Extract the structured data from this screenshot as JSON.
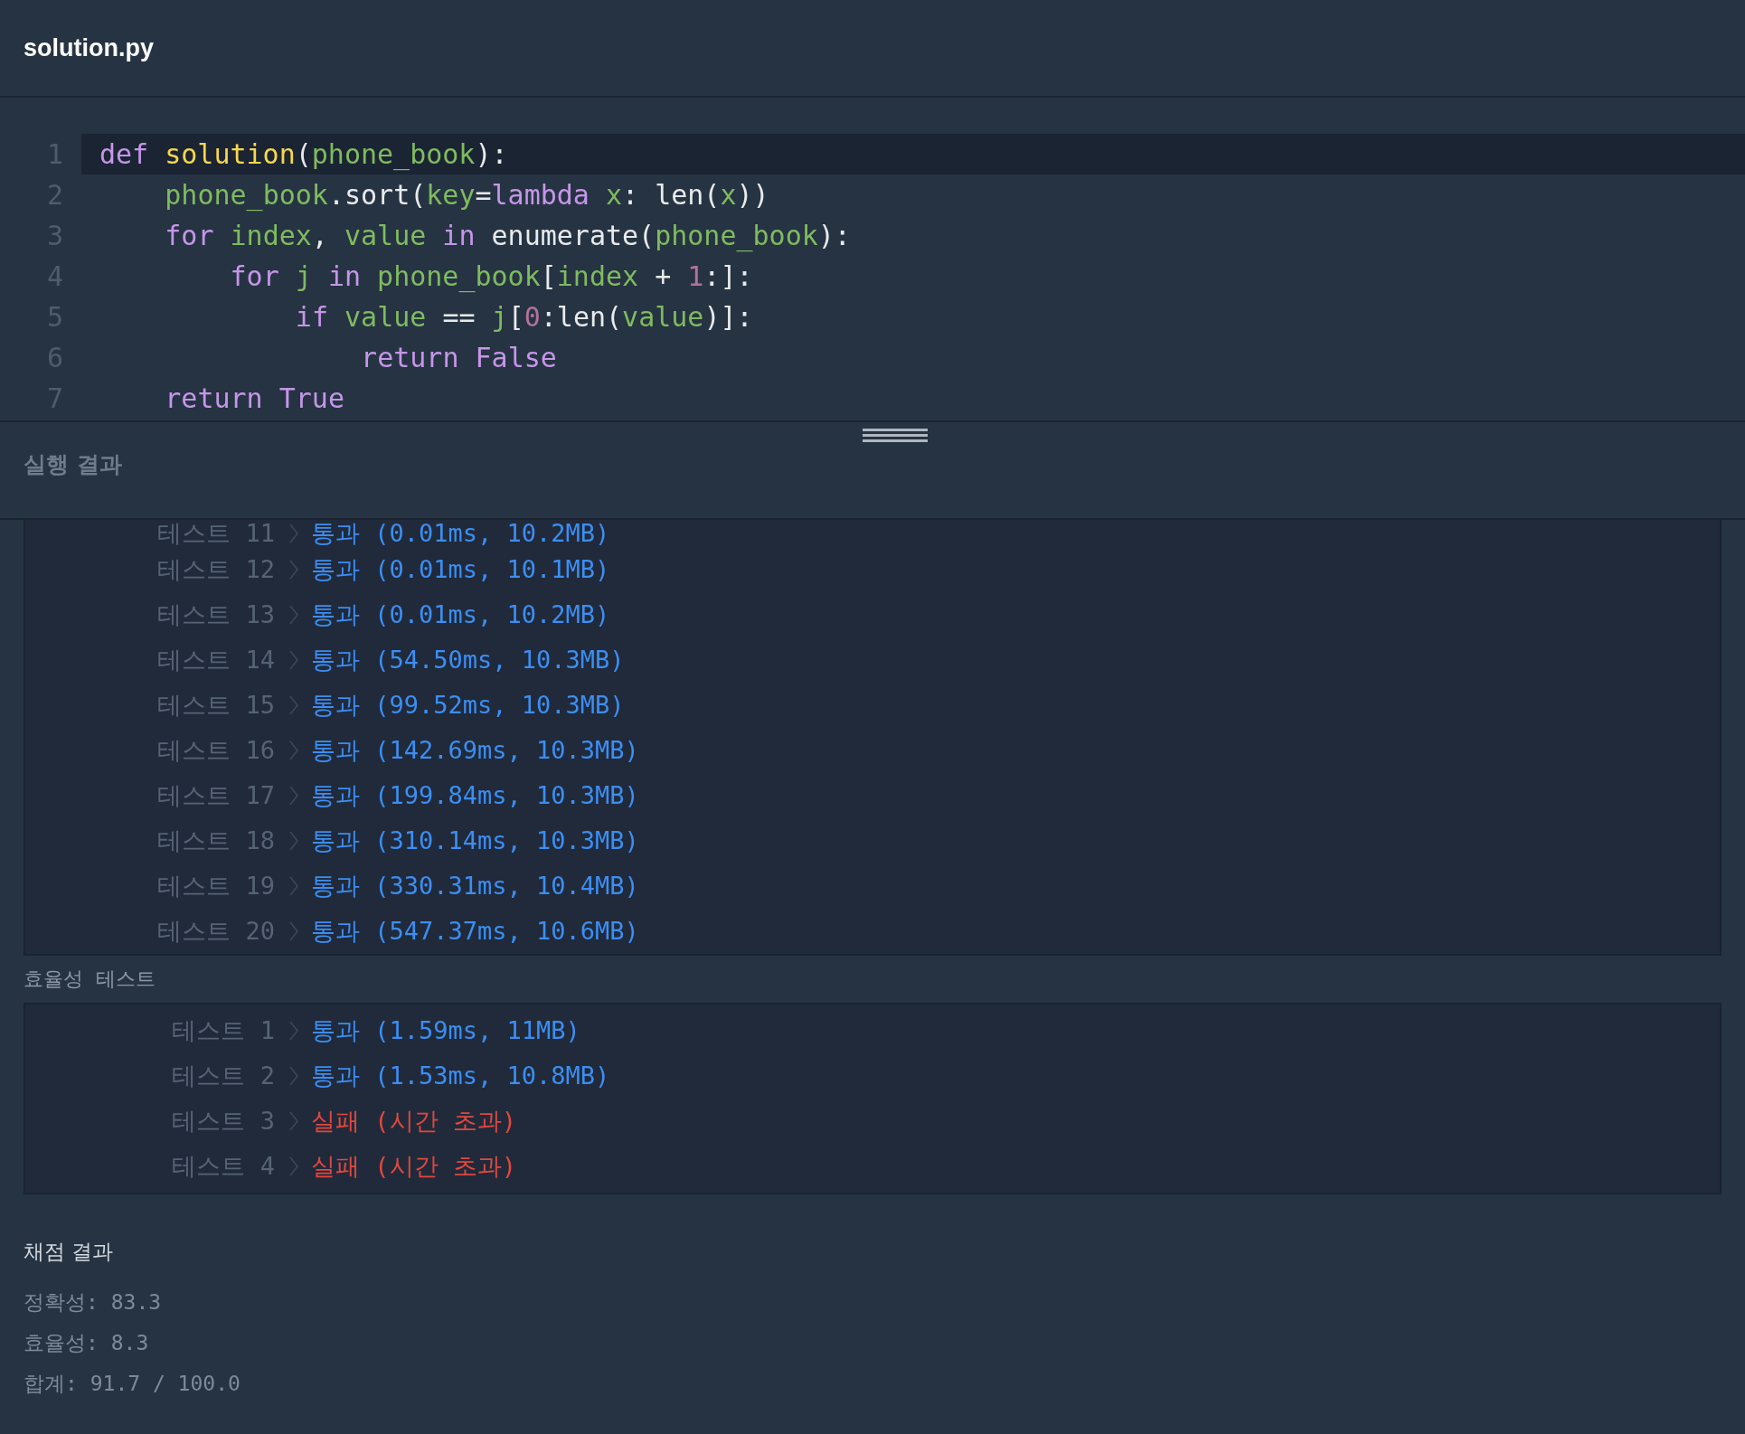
{
  "file_tab": {
    "title": "solution.py"
  },
  "code": {
    "lines": [
      {
        "number": "1",
        "current": true,
        "tokens": [
          {
            "text": "def ",
            "kind": "keyword"
          },
          {
            "text": "solution",
            "kind": "function"
          },
          {
            "text": "(",
            "kind": "plain"
          },
          {
            "text": "phone_book",
            "kind": "name"
          },
          {
            "text": "):",
            "kind": "plain"
          }
        ],
        "children": [
          {
            "number": "2",
            "current": false,
            "tokens": [
              {
                "text": "phone_book",
                "kind": "name"
              },
              {
                "text": ".sort(",
                "kind": "plain"
              },
              {
                "text": "key",
                "kind": "name"
              },
              {
                "text": "=",
                "kind": "plain"
              },
              {
                "text": "lambda ",
                "kind": "keyword"
              },
              {
                "text": "x",
                "kind": "name"
              },
              {
                "text": ": len(",
                "kind": "plain"
              },
              {
                "text": "x",
                "kind": "name"
              },
              {
                "text": "))",
                "kind": "plain"
              }
            ]
          },
          {
            "number": "3",
            "current": false,
            "tokens": [
              {
                "text": "for ",
                "kind": "keyword"
              },
              {
                "text": "index",
                "kind": "name"
              },
              {
                "text": ", ",
                "kind": "plain"
              },
              {
                "text": "value ",
                "kind": "name"
              },
              {
                "text": "in ",
                "kind": "keyword"
              },
              {
                "text": "enumerate(",
                "kind": "plain"
              },
              {
                "text": "phone_book",
                "kind": "name"
              },
              {
                "text": "):",
                "kind": "plain"
              }
            ],
            "children": [
              {
                "number": "4",
                "current": false,
                "tokens": [
                  {
                    "text": "for ",
                    "kind": "keyword"
                  },
                  {
                    "text": "j ",
                    "kind": "name"
                  },
                  {
                    "text": "in ",
                    "kind": "keyword"
                  },
                  {
                    "text": "phone_book",
                    "kind": "name"
                  },
                  {
                    "text": "[",
                    "kind": "plain"
                  },
                  {
                    "text": "index",
                    "kind": "name"
                  },
                  {
                    "text": " + ",
                    "kind": "plain"
                  },
                  {
                    "text": "1",
                    "kind": "number"
                  },
                  {
                    "text": ":]:",
                    "kind": "plain"
                  }
                ],
                "children": [
                  {
                    "number": "5",
                    "current": false,
                    "tokens": [
                      {
                        "text": "if ",
                        "kind": "keyword"
                      },
                      {
                        "text": "value",
                        "kind": "name"
                      },
                      {
                        "text": " == ",
                        "kind": "plain"
                      },
                      {
                        "text": "j",
                        "kind": "name"
                      },
                      {
                        "text": "[",
                        "kind": "plain"
                      },
                      {
                        "text": "0",
                        "kind": "number"
                      },
                      {
                        "text": ":len(",
                        "kind": "plain"
                      },
                      {
                        "text": "value",
                        "kind": "name"
                      },
                      {
                        "text": ")]:",
                        "kind": "plain"
                      }
                    ],
                    "children": [
                      {
                        "number": "6",
                        "current": false,
                        "tokens": [
                          {
                            "text": "return False",
                            "kind": "keyword"
                          }
                        ]
                      }
                    ]
                  }
                ]
              }
            ]
          },
          {
            "number": "7",
            "current": false,
            "tokens": [
              {
                "text": "return True",
                "kind": "keyword"
              }
            ]
          }
        ]
      }
    ]
  },
  "results_panel": {
    "title": "실행 결과"
  },
  "accuracy_tests": [
    {
      "label": "테스트 11",
      "result": "통과 (0.01ms, 10.2MB)",
      "kind": "pass"
    },
    {
      "label": "테스트 12",
      "result": "통과 (0.01ms, 10.1MB)",
      "kind": "pass"
    },
    {
      "label": "테스트 13",
      "result": "통과 (0.01ms, 10.2MB)",
      "kind": "pass"
    },
    {
      "label": "테스트 14",
      "result": "통과 (54.50ms, 10.3MB)",
      "kind": "pass"
    },
    {
      "label": "테스트 15",
      "result": "통과 (99.52ms, 10.3MB)",
      "kind": "pass"
    },
    {
      "label": "테스트 16",
      "result": "통과 (142.69ms, 10.3MB)",
      "kind": "pass"
    },
    {
      "label": "테스트 17",
      "result": "통과 (199.84ms, 10.3MB)",
      "kind": "pass"
    },
    {
      "label": "테스트 18",
      "result": "통과 (310.14ms, 10.3MB)",
      "kind": "pass"
    },
    {
      "label": "테스트 19",
      "result": "통과 (330.31ms, 10.4MB)",
      "kind": "pass"
    },
    {
      "label": "테스트 20",
      "result": "통과 (547.37ms, 10.6MB)",
      "kind": "pass"
    }
  ],
  "efficiency_heading": "효율성  테스트",
  "efficiency_tests": [
    {
      "label": "테스트 1",
      "result": "통과 (1.59ms, 11MB)",
      "kind": "pass"
    },
    {
      "label": "테스트 2",
      "result": "통과 (1.53ms, 10.8MB)",
      "kind": "pass"
    },
    {
      "label": "테스트 3",
      "result": "실패 (시간 초과)",
      "kind": "fail"
    },
    {
      "label": "테스트 4",
      "result": "실패 (시간 초과)",
      "kind": "fail"
    }
  ],
  "grading": {
    "title": "채점 결과",
    "scores": [
      "정확성: 83.3",
      "효율성: 8.3",
      "합계: 91.7 / 100.0"
    ]
  }
}
